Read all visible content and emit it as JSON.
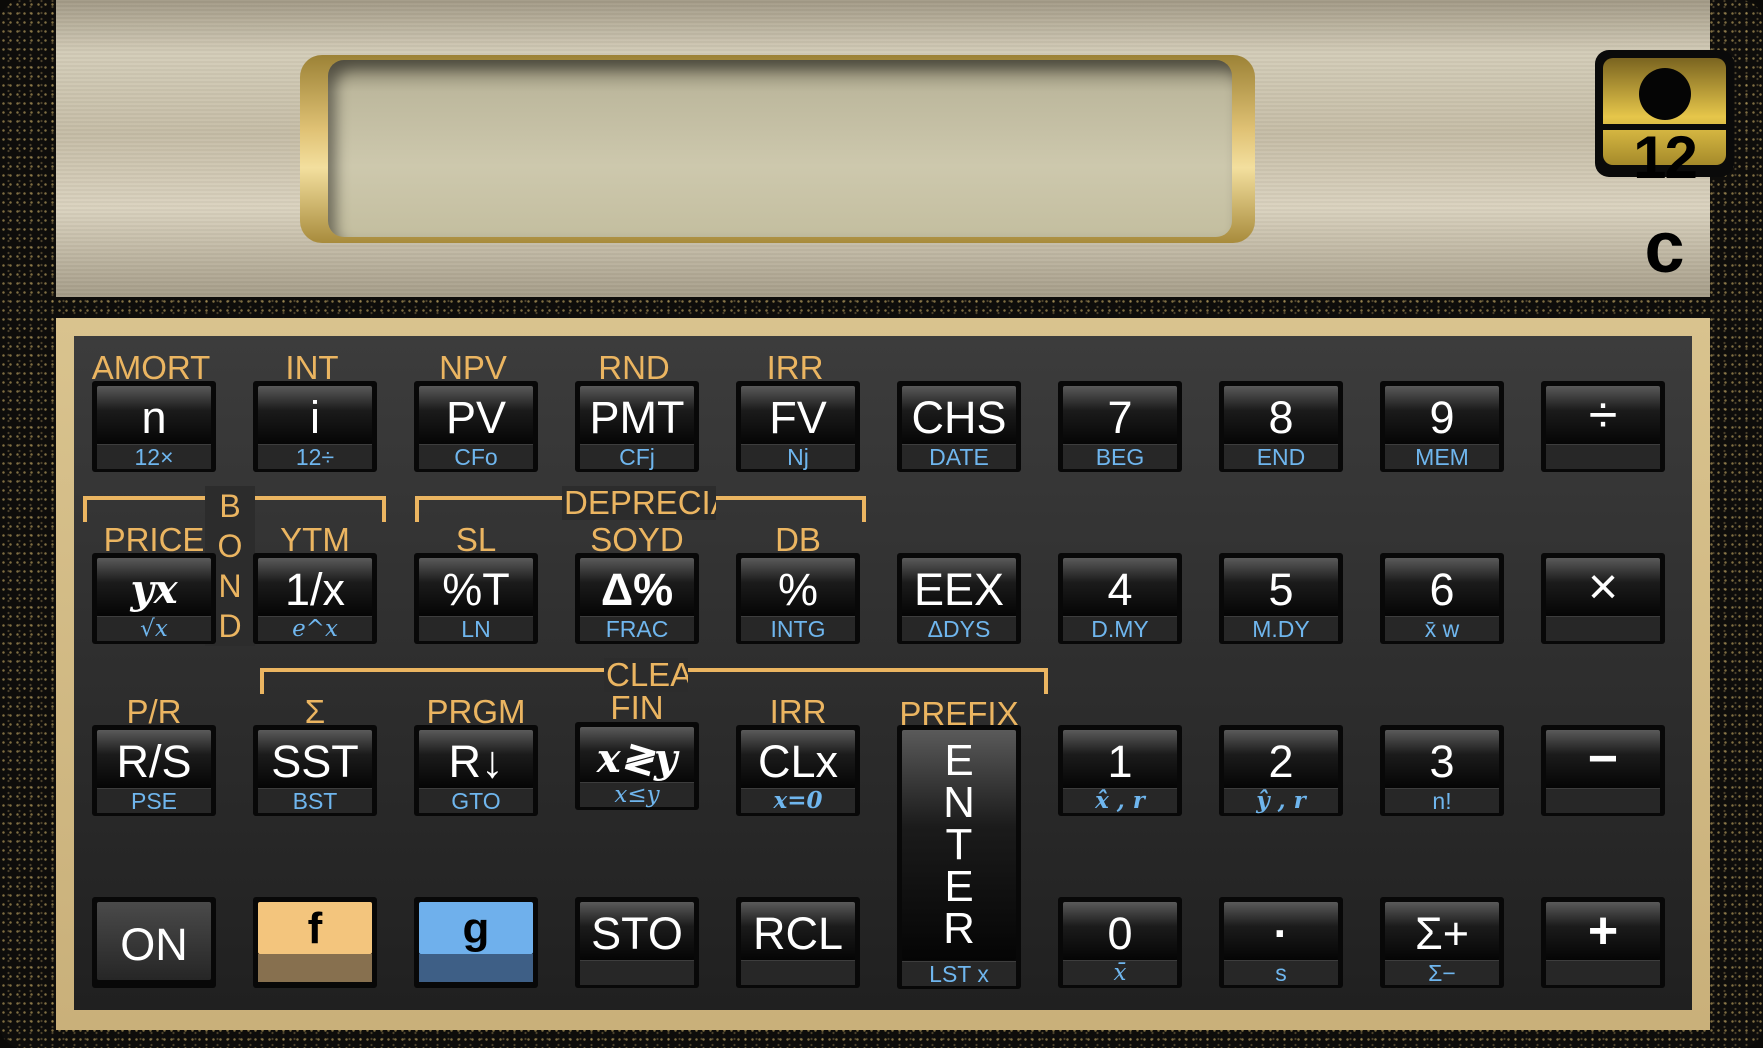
{
  "brand": {
    "logo_number": "12",
    "logo_letter": "c"
  },
  "display": {
    "value": ""
  },
  "colors": {
    "gold": "#ebb561",
    "blue": "#6fb6ee",
    "f_key": "#f3c57d",
    "g_key": "#6fb0ec"
  },
  "row1": {
    "gold": [
      "AMORT",
      "INT",
      "NPV",
      "RND",
      "IRR"
    ],
    "keys": [
      {
        "main": "n",
        "lower": "12×"
      },
      {
        "main": "i",
        "lower": "12÷"
      },
      {
        "main": "PV",
        "lower": "CFo"
      },
      {
        "main": "PMT",
        "lower": "CFj"
      },
      {
        "main": "FV",
        "lower": "Nj"
      },
      {
        "main": "CHS",
        "lower": "DATE"
      },
      {
        "main": "7",
        "lower": "BEG"
      },
      {
        "main": "8",
        "lower": "END"
      },
      {
        "main": "9",
        "lower": "MEM"
      },
      {
        "main": "÷",
        "lower": ""
      }
    ]
  },
  "row2": {
    "gold": [
      "PRICE",
      "YTM",
      "SL",
      "SOYD",
      "DB"
    ],
    "bracket_labels": [
      "BOND",
      "DEPRECIATION"
    ],
    "keys": [
      {
        "main": "yx",
        "lower": "√x"
      },
      {
        "main": "1/x",
        "lower": "e^x"
      },
      {
        "main": "%T",
        "lower": "LN"
      },
      {
        "main": "Δ%",
        "lower": "FRAC"
      },
      {
        "main": "%",
        "lower": "INTG"
      },
      {
        "main": "EEX",
        "lower": "ΔDYS"
      },
      {
        "main": "4",
        "lower": "D.MY"
      },
      {
        "main": "5",
        "lower": "M.DY"
      },
      {
        "main": "6",
        "lower": "x̄ w"
      },
      {
        "main": "×",
        "lower": ""
      }
    ]
  },
  "row3": {
    "gold": [
      "P/R",
      "Σ",
      "PRGM",
      "FIN",
      "IRR",
      "PREFIX"
    ],
    "bracket_labels": [
      "CLEAR"
    ],
    "keys": [
      {
        "main": "R/S",
        "lower": "PSE"
      },
      {
        "main": "SST",
        "lower": "BST"
      },
      {
        "main": "R↓",
        "lower": "GTO"
      },
      {
        "main": "x≷y",
        "lower": "x≤y"
      },
      {
        "main": "CLx",
        "lower": "x=0"
      },
      {
        "main": "1",
        "lower": "x̂ , r"
      },
      {
        "main": "2",
        "lower": "ŷ , r"
      },
      {
        "main": "3",
        "lower": "n!"
      },
      {
        "main": "−",
        "lower": ""
      }
    ]
  },
  "row4": {
    "keys": [
      {
        "main": "ON"
      },
      {
        "main": "f"
      },
      {
        "main": "g"
      },
      {
        "main": "STO",
        "lower": ""
      },
      {
        "main": "RCL",
        "lower": ""
      },
      {
        "main": "0",
        "lower": "x̄"
      },
      {
        "main": "·",
        "lower": "s"
      },
      {
        "main": "Σ+",
        "lower": "Σ−"
      },
      {
        "main": "+",
        "lower": ""
      }
    ]
  },
  "enter_key": {
    "main": "ENTER",
    "lower": "LST x"
  }
}
